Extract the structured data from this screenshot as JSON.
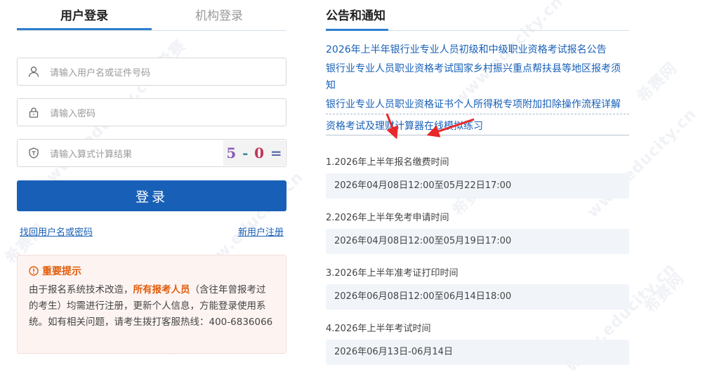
{
  "login": {
    "tabs": [
      {
        "label": "用户登录",
        "active": true
      },
      {
        "label": "机构登录",
        "active": false
      }
    ],
    "username_placeholder": "请输入用户名或证件号码",
    "password_placeholder": "请输入密码",
    "captcha_placeholder": "请输入算式计算结果",
    "captcha_chars": [
      "5",
      "-",
      "0",
      "="
    ],
    "login_button": "登录",
    "forgot_link": "找回用户名或密码",
    "register_link": "新用户注册"
  },
  "notice": {
    "title": "重要提示",
    "text_before": "由于报名系统技术改造，",
    "text_highlight": "所有报考人员",
    "text_after": "（含往年曾报考过的考生）均需进行注册，更新个人信息，方能登录使用系统。如有相关问题，请考生拨打客服热线：400-6836066"
  },
  "announcements": {
    "title": "公告和通知",
    "items": [
      "2026年上半年银行业专业人员初级和中级职业资格考试报名公告",
      "银行业专业人员职业资格考试国家乡村振兴重点帮扶县等地区报考须知",
      "银行业专业人员职业资格证书个人所得税专项附加扣除操作流程详解",
      "资格考试及理财计算器在线模拟练习"
    ]
  },
  "schedule": [
    {
      "label": "1.2026年上半年报名缴费时间",
      "value": "2026年04月08日12:00至05月22日17:00"
    },
    {
      "label": "2.2026年上半年免考申请时间",
      "value": "2026年04月08日12:00至05月19日17:00"
    },
    {
      "label": "3.2026年上半年准考证打印时间",
      "value": "2026年06月08日12:00至06月14日18:00"
    },
    {
      "label": "4.2026年上半年考试时间",
      "value": "2026年06月13日-06月14日"
    }
  ],
  "watermark": {
    "site": "www.educity.cn",
    "brand": "希赛",
    "brand2": "希赛网"
  },
  "colors": {
    "accent": "#1860b7",
    "warning": "#e15c0a",
    "arrow": "#e8282a",
    "notice_bg": "#fdf4f2"
  }
}
